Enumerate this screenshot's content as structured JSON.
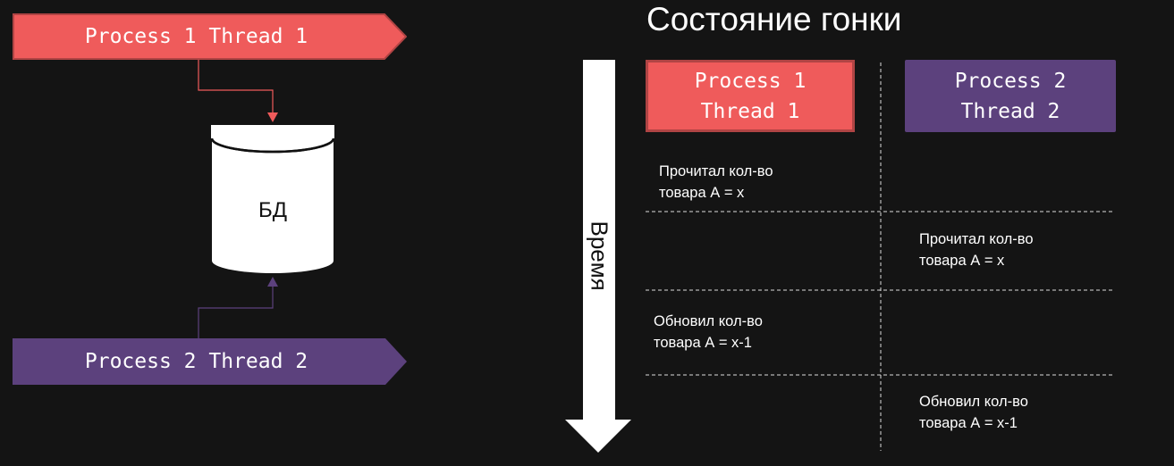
{
  "left_diagram": {
    "process1": {
      "label": "Process 1 Thread 1",
      "color": "#ef5b5b"
    },
    "process2": {
      "label": "Process 2 Thread 2",
      "color": "#5c417d"
    },
    "database": {
      "label": "БД"
    }
  },
  "right_table": {
    "title": "Состояние гонки",
    "time_axis_label": "Время",
    "columns": [
      {
        "label": "Process 1\nThread 1",
        "color": "#ef5b5b"
      },
      {
        "label": "Process 2\nThread 2",
        "color": "#5c417d"
      }
    ],
    "steps": [
      {
        "column": 1,
        "text": "Прочитал кол-во\nтовара А = x"
      },
      {
        "column": 2,
        "text": "Прочитал кол-во\nтовара А = x"
      },
      {
        "column": 1,
        "text": "Обновил кол-во\nтовара А = x-1"
      },
      {
        "column": 2,
        "text": "Обновил кол-во\nтовара А = x-1"
      }
    ]
  }
}
